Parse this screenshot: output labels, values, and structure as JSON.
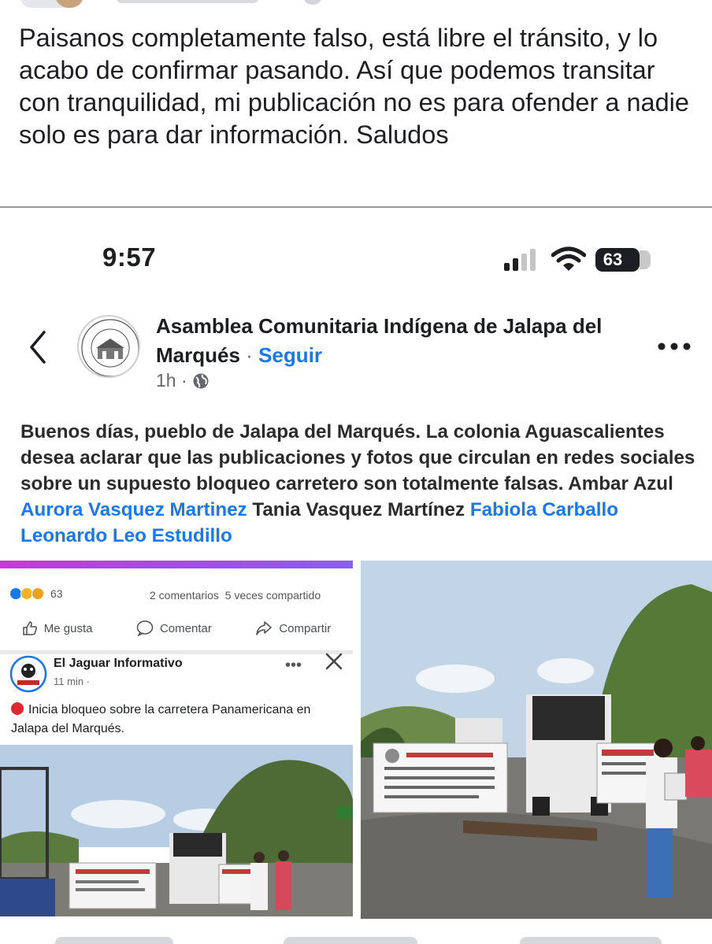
{
  "post": {
    "text": "Paisanos completamente falso, está libre el tránsito, y lo acabo de confirmar pasando. Así que podemos transitar con tranquilidad, mi publicación no es para ofender a nadie solo es para dar información.  Saludos"
  },
  "shared_screenshot": {
    "status_bar": {
      "time": "9:57",
      "battery": "63"
    },
    "page": {
      "name": "Asamblea Comunitaria Indígena de Jalapa del Marqués",
      "separator": "·",
      "follow_label": "Seguir",
      "time": "1h ·"
    },
    "body": {
      "text_start": "Buenos días, pueblo de Jalapa del Marqués. La colonia Aguascalientes desea aclarar que las publicaciones y fotos que circulan en redes sociales sobre un supuesto bloqueo carretero son totalmente falsas. Ambar Azul ",
      "tag1": "Aurora Vasquez Martinez",
      "text_mid": " Tania Vasquez Martínez ",
      "tag2": "Fabiola Carballo Leonardo Leo Estudillo"
    },
    "embedded_post": {
      "reactions_count": "63",
      "comments": "2 comentarios",
      "shares": "5 veces compartido",
      "like_label": "Me gusta",
      "comment_label": "Comentar",
      "share_label": "Compartir",
      "author": "El Jaguar Informativo",
      "time": "11 min ·",
      "text": "Inicia bloqueo sobre la carretera Panamericana en Jalapa del Marqués."
    }
  },
  "colors": {
    "accent": "#1877f2",
    "text": "#1c1e21",
    "muted": "#65676b",
    "reaction_like": "#1877f2",
    "reaction_wow": "#f7b125",
    "red_dot": "#e0272f"
  }
}
